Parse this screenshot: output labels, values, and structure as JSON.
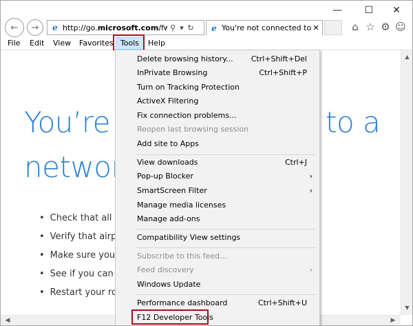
{
  "window": {
    "minimize_glyph": "—",
    "maximize_glyph": "☐",
    "close_glyph": "✕"
  },
  "nav": {
    "back_glyph": "←",
    "forward_glyph": "→"
  },
  "address": {
    "favicon": "e",
    "url_prefix": "http://go.",
    "url_domain": "microsoft.com",
    "url_rest": "/fwlinl",
    "search_glyph": "⚲",
    "dropdown_glyph": "▾",
    "refresh_glyph": "↻"
  },
  "tab": {
    "favicon": "e",
    "title": "You're not connected to ...",
    "close_glyph": "✕"
  },
  "toolbar_icons": {
    "home": "⌂",
    "favorites": "☆",
    "settings": "⚙",
    "smiley": "☺"
  },
  "menubar": {
    "items": [
      {
        "label": "File"
      },
      {
        "label": "Edit"
      },
      {
        "label": "View"
      },
      {
        "label": "Favorites"
      },
      {
        "label": "Tools"
      },
      {
        "label": "Help"
      }
    ]
  },
  "page": {
    "headline_left_1": "You’re",
    "headline_right_1": "to a",
    "headline_left_2": "networ",
    "bullets": [
      "Check that all n",
      "Verify that airpl",
      "Make sure your",
      "See if you can c",
      "Restart your ro"
    ]
  },
  "tools_menu": {
    "items": [
      {
        "label": "Delete browsing history...",
        "shortcut": "Ctrl+Shift+Del",
        "disabled": false,
        "submenu": false
      },
      {
        "label": "InPrivate Browsing",
        "shortcut": "Ctrl+Shift+P",
        "disabled": false,
        "submenu": false
      },
      {
        "label": "Turn on Tracking Protection",
        "shortcut": "",
        "disabled": false,
        "submenu": false
      },
      {
        "label": "ActiveX Filtering",
        "shortcut": "",
        "disabled": false,
        "submenu": false
      },
      {
        "label": "Fix connection problems...",
        "shortcut": "",
        "disabled": false,
        "submenu": false
      },
      {
        "label": "Reopen last browsing session",
        "shortcut": "",
        "disabled": true,
        "submenu": false
      },
      {
        "label": "Add site to Apps",
        "shortcut": "",
        "disabled": false,
        "submenu": false
      },
      {
        "label": "View downloads",
        "shortcut": "Ctrl+J",
        "disabled": false,
        "submenu": false
      },
      {
        "label": "Pop-up Blocker",
        "shortcut": "",
        "disabled": false,
        "submenu": true
      },
      {
        "label": "SmartScreen Filter",
        "shortcut": "",
        "disabled": false,
        "submenu": true
      },
      {
        "label": "Manage media licenses",
        "shortcut": "",
        "disabled": false,
        "submenu": false
      },
      {
        "label": "Manage add-ons",
        "shortcut": "",
        "disabled": false,
        "submenu": false
      },
      {
        "label": "Compatibility View settings",
        "shortcut": "",
        "disabled": false,
        "submenu": false
      },
      {
        "label": "Subscribe to this feed...",
        "shortcut": "",
        "disabled": true,
        "submenu": false
      },
      {
        "label": "Feed discovery",
        "shortcut": "",
        "disabled": true,
        "submenu": true
      },
      {
        "label": "Windows Update",
        "shortcut": "",
        "disabled": false,
        "submenu": false
      },
      {
        "label": "Performance dashboard",
        "shortcut": "Ctrl+Shift+U",
        "disabled": false,
        "submenu": false
      },
      {
        "label": "F12 Developer Tools",
        "shortcut": "",
        "disabled": false,
        "submenu": false
      }
    ],
    "submenu_glyph": "›"
  },
  "scrollbars": {
    "up": "▲",
    "down": "▼",
    "left": "◀",
    "right": "▶"
  },
  "colors": {
    "headline": "#2b7fd6",
    "highlight_border": "#b00b1e",
    "menu_active_bg": "#cce8ff"
  }
}
